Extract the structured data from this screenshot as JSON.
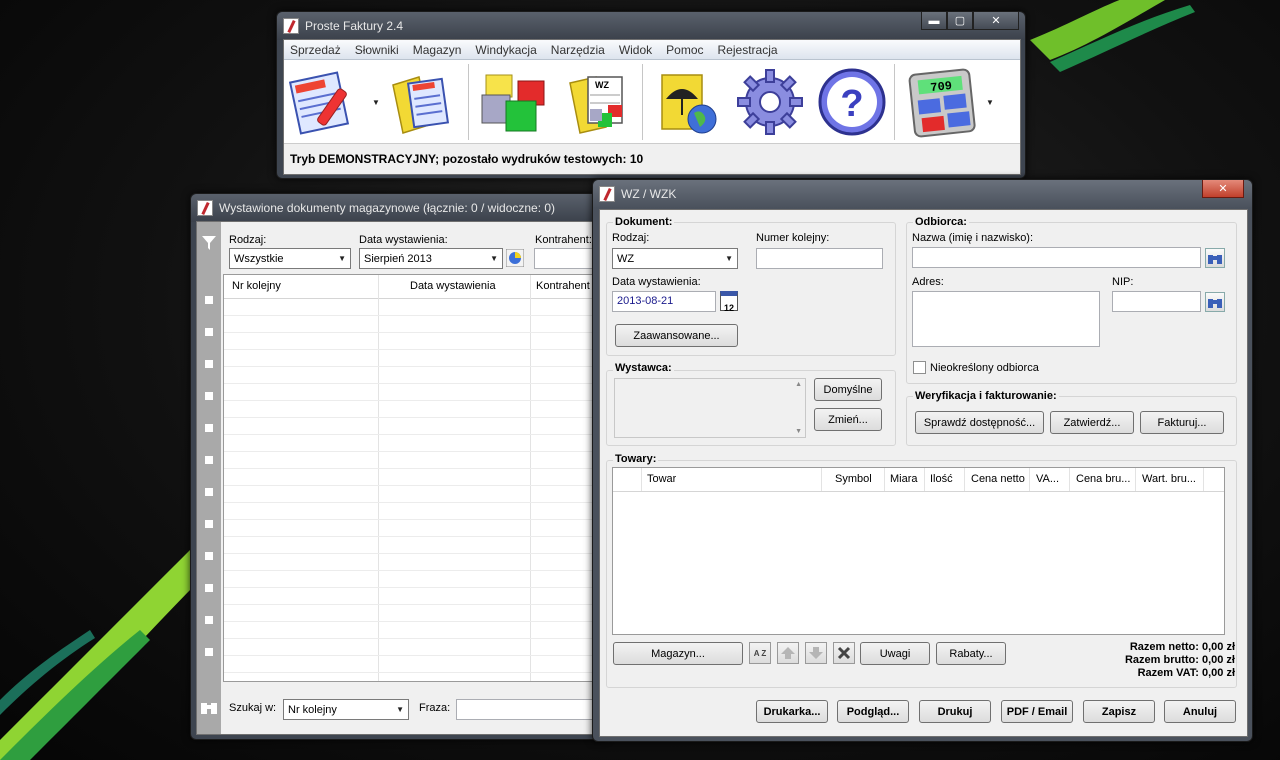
{
  "main_window": {
    "title": "Proste Faktury 2.4",
    "menu": [
      "Sprzedaż",
      "Słowniki",
      "Magazyn",
      "Windykacja",
      "Narzędzia",
      "Widok",
      "Pomoc",
      "Rejestracja"
    ],
    "toolbar_icons": [
      "invoice-icon",
      "invoice-list-icon",
      "warehouse-boxes-icon",
      "wz-document-icon",
      "umbrella-document-icon",
      "settings-gear-icon",
      "help-icon",
      "calculator-icon"
    ],
    "calculator_display": "709",
    "status": "Tryb DEMONSTRACYJNY; pozostało wydruków testowych: 10",
    "controls": {
      "minimize": "▬",
      "maximize": "▢",
      "close": "✕"
    }
  },
  "list_window": {
    "title": "Wystawione dokumenty magazynowe (łącznie: 0 / widoczne: 0)",
    "rodzaj_label": "Rodzaj:",
    "rodzaj_value": "Wszystkie",
    "data_label": "Data wystawienia:",
    "data_value": "Sierpień 2013",
    "kontrahent_label": "Kontrahent:",
    "columns": [
      "Nr kolejny",
      "Data wystawienia",
      "Kontrahent"
    ],
    "row_count": 23,
    "szukaj_label": "Szukaj w:",
    "szukaj_value": "Nr kolejny",
    "fraza_label": "Fraza:"
  },
  "wz_window": {
    "title": "WZ / WZK",
    "close": "✕",
    "dokument": {
      "group": "Dokument:",
      "rodzaj_label": "Rodzaj:",
      "rodzaj_value": "WZ",
      "numer_label": "Numer kolejny:",
      "data_label": "Data wystawienia:",
      "data_value": "2013-08-21",
      "calendar_day": "12",
      "advanced_button": "Zaawansowane..."
    },
    "odbiorca": {
      "group": "Odbiorca:",
      "nazwa_label": "Nazwa (imię i nazwisko):",
      "adres_label": "Adres:",
      "nip_label": "NIP:",
      "nieokreslony_label": "Nieokreślony odbiorca"
    },
    "wystawca": {
      "group": "Wystawca:",
      "default_button": "Domyślne",
      "change_button": "Zmień..."
    },
    "weryfikacja": {
      "group": "Weryfikacja i fakturowanie:",
      "check_button": "Sprawdź dostępność...",
      "approve_button": "Zatwierdź...",
      "invoice_button": "Fakturuj..."
    },
    "towary": {
      "group": "Towary:",
      "columns": [
        "Towar",
        "Symbol",
        "Miara",
        "Ilość",
        "Cena netto",
        "VA...",
        "Cena bru...",
        "Wart. bru..."
      ],
      "magazyn_button": "Magazyn...",
      "uwagi_button": "Uwagi",
      "rabaty_button": "Rabaty...",
      "sort_icon_text": "A Z",
      "razem_netto": "Razem netto: 0,00 zł",
      "razem_brutto": "Razem brutto: 0,00 zł",
      "razem_vat": "Razem VAT: 0,00 zł"
    },
    "footer_buttons": [
      "Drukarka...",
      "Podgląd...",
      "Drukuj",
      "PDF / Email",
      "Zapisz",
      "Anuluj"
    ]
  }
}
